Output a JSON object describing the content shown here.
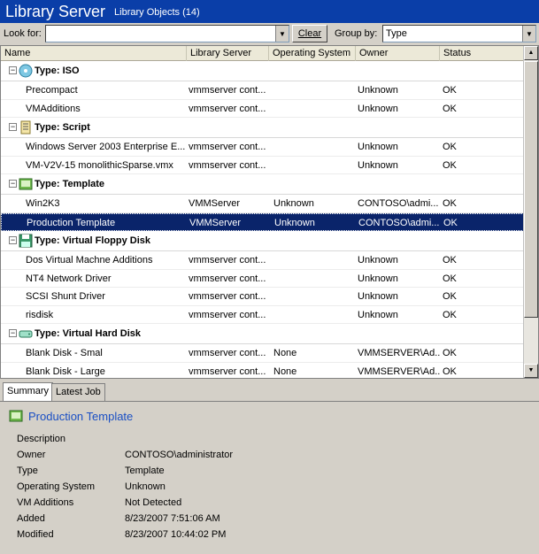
{
  "title": {
    "app": "Library Server",
    "view": "Library Objects (14)"
  },
  "toolbar": {
    "lookfor_label": "Look for:",
    "lookfor_value": "",
    "clear_label": "Clear",
    "groupby_label": "Group by:",
    "groupby_value": "Type"
  },
  "columns": [
    "Name",
    "Library Server",
    "Operating System",
    "Owner",
    "Status"
  ],
  "groups": [
    {
      "label": "Type: ISO",
      "icon": "disc-icon",
      "rows": [
        [
          "Precompact",
          "vmmserver cont...",
          "",
          "Unknown",
          "OK"
        ],
        [
          "VMAdditions",
          "vmmserver cont...",
          "",
          "Unknown",
          "OK"
        ]
      ]
    },
    {
      "label": "Type: Script",
      "icon": "script-icon",
      "rows": [
        [
          "Windows Server 2003 Enterprise E...",
          "vmmserver cont...",
          "",
          "Unknown",
          "OK"
        ],
        [
          "VM-V2V-15 monolithicSparse.vmx",
          "vmmserver cont...",
          "",
          "Unknown",
          "OK"
        ]
      ]
    },
    {
      "label": "Type: Template",
      "icon": "template-icon",
      "rows": [
        [
          "Win2K3",
          "VMMServer",
          "Unknown",
          "CONTOSO\\admi...",
          "OK"
        ],
        [
          "Production Template",
          "VMMServer",
          "Unknown",
          "CONTOSO\\admi...",
          "OK"
        ]
      ]
    },
    {
      "label": "Type: Virtual Floppy Disk",
      "icon": "floppy-icon",
      "rows": [
        [
          "Dos Virtual Machne Additions",
          "vmmserver cont...",
          "",
          "Unknown",
          "OK"
        ],
        [
          "NT4 Network Driver",
          "vmmserver cont...",
          "",
          "Unknown",
          "OK"
        ],
        [
          "SCSI Shunt Driver",
          "vmmserver cont...",
          "",
          "Unknown",
          "OK"
        ],
        [
          "risdisk",
          "vmmserver cont...",
          "",
          "Unknown",
          "OK"
        ]
      ]
    },
    {
      "label": "Type: Virtual Hard Disk",
      "icon": "hard-disk-icon",
      "rows": [
        [
          "Blank Disk - Smal",
          "vmmserver cont...",
          "None",
          "VMMSERVER\\Ad...",
          "OK"
        ],
        [
          "Blank Disk - Large",
          "vmmserver cont...",
          "None",
          "VMMSERVER\\Ad...",
          "OK"
        ]
      ]
    }
  ],
  "tabs": [
    "Summary",
    "Latest Job"
  ],
  "details": {
    "title": "Production Template",
    "section": "Description",
    "fields": [
      [
        "Owner",
        "CONTOSO\\administrator"
      ],
      [
        "Type",
        "Template"
      ],
      [
        "Operating System",
        "Unknown"
      ],
      [
        "VM Additions",
        "Not Detected"
      ],
      [
        "Added",
        "8/23/2007 7:51:06 AM"
      ],
      [
        "Modified",
        "8/23/2007 10:44:02 PM"
      ]
    ]
  },
  "colors": {
    "title_bg": "#0a3ea8",
    "selection_bg": "#0a246a",
    "detail_title": "#1a4fc4"
  }
}
